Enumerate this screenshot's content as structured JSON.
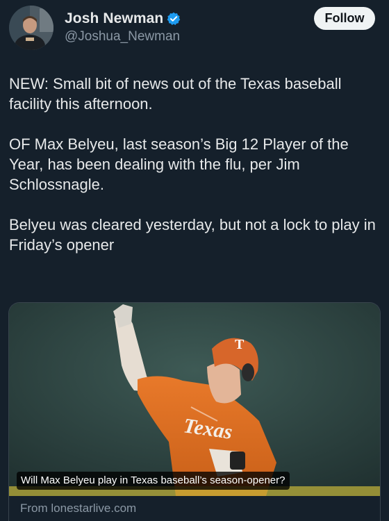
{
  "author": {
    "display_name": "Josh Newman",
    "handle": "@Joshua_Newman",
    "verified": true,
    "verified_color": "#1d9bf0"
  },
  "follow_button": {
    "label": "Follow"
  },
  "tweet": {
    "paragraphs": [
      "NEW: Small bit of news out of the Texas baseball facility this afternoon.",
      "OF Max Belyeu, last season’s Big 12 Player of the Year, has been dealing with the flu, per Jim Schlossnagle.",
      "Belyeu was cleared yesterday, but not a lock to play in Friday’s opener"
    ]
  },
  "link_card": {
    "image_caption": "Will Max Belyeu play in Texas baseball’s season-opener?",
    "source": "From lonestarlive.com",
    "jersey_text": "Texas",
    "helmet_logo": "T"
  },
  "colors": {
    "background": "#15202b",
    "text": "#e7e9ea",
    "secondary_text": "#8b98a5",
    "uniform_orange": "#e0701f"
  }
}
